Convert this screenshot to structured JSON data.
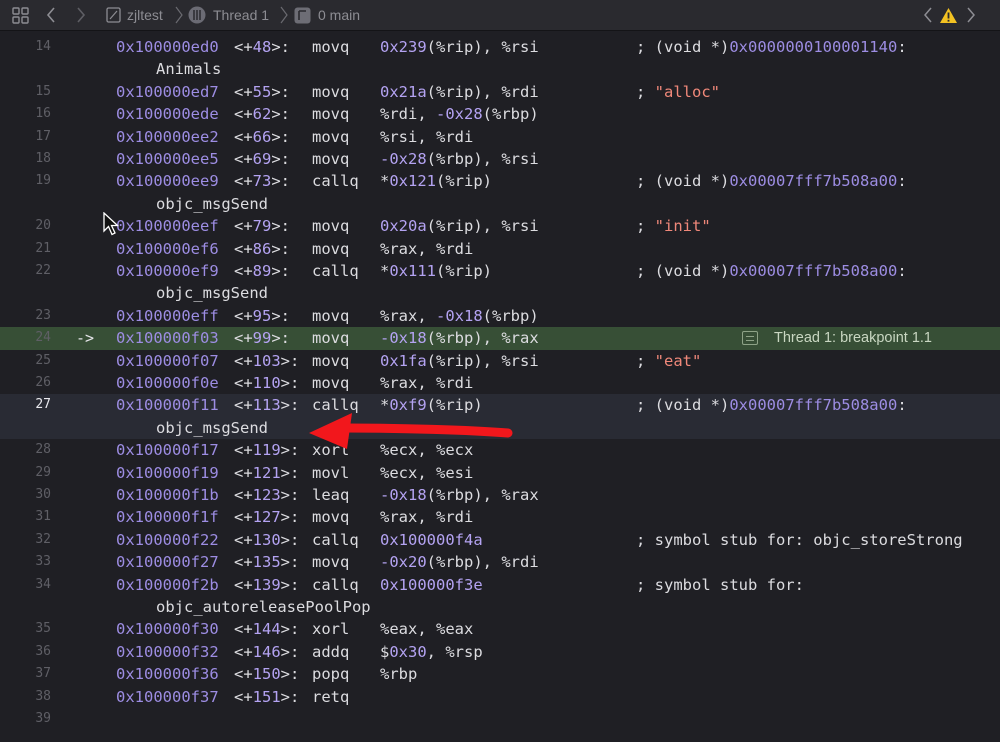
{
  "jumpbar": {
    "project": "zjltest",
    "thread": "Thread 1",
    "frame": "0 main"
  },
  "colors": {
    "background": "#1f1f24",
    "address": "#9d8de3",
    "number": "#b4a3f2",
    "string": "#f0887a",
    "breakpoint_line": "#374f36",
    "annotation_arrow": "#f2171c"
  },
  "breakpoint": {
    "line": 24,
    "marker": "->",
    "label": "Thread 1: breakpoint 1.1"
  },
  "current_line": 27,
  "rows": [
    {
      "ln": "14",
      "addr": "0x100000ed0",
      "off": "<+48>:",
      "op": "movq",
      "a": [
        [
          "num",
          "0x239"
        ],
        [
          "txt",
          "(%rip), %rsi"
        ]
      ],
      "c": [
        [
          "txt",
          "; (void *)"
        ],
        [
          "addr",
          "0x0000000100001140"
        ],
        [
          "txt",
          ":"
        ]
      ]
    },
    {
      "cont": "Animals"
    },
    {
      "ln": "15",
      "addr": "0x100000ed7",
      "off": "<+55>:",
      "op": "movq",
      "a": [
        [
          "num",
          "0x21a"
        ],
        [
          "txt",
          "(%rip), %rdi"
        ]
      ],
      "c": [
        [
          "txt",
          "; "
        ],
        [
          "str",
          "\"alloc\""
        ]
      ]
    },
    {
      "ln": "16",
      "addr": "0x100000ede",
      "off": "<+62>:",
      "op": "movq",
      "a": [
        [
          "txt",
          "%rdi, "
        ],
        [
          "num",
          "-0x28"
        ],
        [
          "txt",
          "(%rbp)"
        ]
      ]
    },
    {
      "ln": "17",
      "addr": "0x100000ee2",
      "off": "<+66>:",
      "op": "movq",
      "a": [
        [
          "txt",
          "%rsi, %rdi"
        ]
      ]
    },
    {
      "ln": "18",
      "addr": "0x100000ee5",
      "off": "<+69>:",
      "op": "movq",
      "a": [
        [
          "num",
          "-0x28"
        ],
        [
          "txt",
          "(%rbp), %rsi"
        ]
      ]
    },
    {
      "ln": "19",
      "addr": "0x100000ee9",
      "off": "<+73>:",
      "op": "callq",
      "a": [
        [
          "txt",
          "*"
        ],
        [
          "num",
          "0x121"
        ],
        [
          "txt",
          "(%rip)"
        ]
      ],
      "c": [
        [
          "txt",
          "; (void *)"
        ],
        [
          "addr",
          "0x00007fff7b508a00"
        ],
        [
          "txt",
          ":"
        ]
      ]
    },
    {
      "cont": "objc_msgSend"
    },
    {
      "ln": "20",
      "addr": "0x100000eef",
      "off": "<+79>:",
      "op": "movq",
      "a": [
        [
          "num",
          "0x20a"
        ],
        [
          "txt",
          "(%rip), %rsi"
        ]
      ],
      "c": [
        [
          "txt",
          "; "
        ],
        [
          "str",
          "\"init\""
        ]
      ]
    },
    {
      "ln": "21",
      "addr": "0x100000ef6",
      "off": "<+86>:",
      "op": "movq",
      "a": [
        [
          "txt",
          "%rax, %rdi"
        ]
      ]
    },
    {
      "ln": "22",
      "addr": "0x100000ef9",
      "off": "<+89>:",
      "op": "callq",
      "a": [
        [
          "txt",
          "*"
        ],
        [
          "num",
          "0x111"
        ],
        [
          "txt",
          "(%rip)"
        ]
      ],
      "c": [
        [
          "txt",
          "; (void *)"
        ],
        [
          "addr",
          "0x00007fff7b508a00"
        ],
        [
          "txt",
          ":"
        ]
      ]
    },
    {
      "cont": "objc_msgSend"
    },
    {
      "ln": "23",
      "addr": "0x100000eff",
      "off": "<+95>:",
      "op": "movq",
      "a": [
        [
          "txt",
          "%rax, "
        ],
        [
          "num",
          "-0x18"
        ],
        [
          "txt",
          "(%rbp)"
        ]
      ]
    },
    {
      "ln": "24",
      "addr": "0x100000f03",
      "off": "<+99>:",
      "op": "movq",
      "a": [
        [
          "num",
          "-0x18"
        ],
        [
          "txt",
          "(%rbp), %rax"
        ]
      ]
    },
    {
      "ln": "25",
      "addr": "0x100000f07",
      "off": "<+103>:",
      "op": "movq",
      "a": [
        [
          "num",
          "0x1fa"
        ],
        [
          "txt",
          "(%rip), %rsi"
        ]
      ],
      "c": [
        [
          "txt",
          "; "
        ],
        [
          "str",
          "\"eat\""
        ]
      ]
    },
    {
      "ln": "26",
      "addr": "0x100000f0e",
      "off": "<+110>:",
      "op": "movq",
      "a": [
        [
          "txt",
          "%rax, %rdi"
        ]
      ]
    },
    {
      "ln": "27",
      "addr": "0x100000f11",
      "off": "<+113>:",
      "op": "callq",
      "a": [
        [
          "txt",
          "*"
        ],
        [
          "num",
          "0xf9"
        ],
        [
          "txt",
          "(%rip)"
        ]
      ],
      "c": [
        [
          "txt",
          "; (void *)"
        ],
        [
          "addr",
          "0x00007fff7b508a00"
        ],
        [
          "txt",
          ":"
        ]
      ]
    },
    {
      "cont": "objc_msgSend"
    },
    {
      "ln": "28",
      "addr": "0x100000f17",
      "off": "<+119>:",
      "op": "xorl",
      "a": [
        [
          "txt",
          "%ecx, %ecx"
        ]
      ]
    },
    {
      "ln": "29",
      "addr": "0x100000f19",
      "off": "<+121>:",
      "op": "movl",
      "a": [
        [
          "txt",
          "%ecx, %esi"
        ]
      ]
    },
    {
      "ln": "30",
      "addr": "0x100000f1b",
      "off": "<+123>:",
      "op": "leaq",
      "a": [
        [
          "num",
          "-0x18"
        ],
        [
          "txt",
          "(%rbp), %rax"
        ]
      ]
    },
    {
      "ln": "31",
      "addr": "0x100000f1f",
      "off": "<+127>:",
      "op": "movq",
      "a": [
        [
          "txt",
          "%rax, %rdi"
        ]
      ]
    },
    {
      "ln": "32",
      "addr": "0x100000f22",
      "off": "<+130>:",
      "op": "callq",
      "a": [
        [
          "num",
          "0x100000f4a"
        ]
      ],
      "c": [
        [
          "txt",
          "; symbol stub for: objc_storeStrong"
        ]
      ]
    },
    {
      "ln": "33",
      "addr": "0x100000f27",
      "off": "<+135>:",
      "op": "movq",
      "a": [
        [
          "num",
          "-0x20"
        ],
        [
          "txt",
          "(%rbp), %rdi"
        ]
      ]
    },
    {
      "ln": "34",
      "addr": "0x100000f2b",
      "off": "<+139>:",
      "op": "callq",
      "a": [
        [
          "num",
          "0x100000f3e"
        ]
      ],
      "c": [
        [
          "txt",
          "; symbol stub for:"
        ]
      ]
    },
    {
      "cont": "objc_autoreleasePoolPop"
    },
    {
      "ln": "35",
      "addr": "0x100000f30",
      "off": "<+144>:",
      "op": "xorl",
      "a": [
        [
          "txt",
          "%eax, %eax"
        ]
      ]
    },
    {
      "ln": "36",
      "addr": "0x100000f32",
      "off": "<+146>:",
      "op": "addq",
      "a": [
        [
          "txt",
          "$"
        ],
        [
          "num",
          "0x30"
        ],
        [
          "txt",
          ", %rsp"
        ]
      ]
    },
    {
      "ln": "37",
      "addr": "0x100000f36",
      "off": "<+150>:",
      "op": "popq",
      "a": [
        [
          "txt",
          "%rbp"
        ]
      ]
    },
    {
      "ln": "38",
      "addr": "0x100000f37",
      "off": "<+151>:",
      "op": "retq"
    },
    {
      "ln": "39"
    }
  ]
}
